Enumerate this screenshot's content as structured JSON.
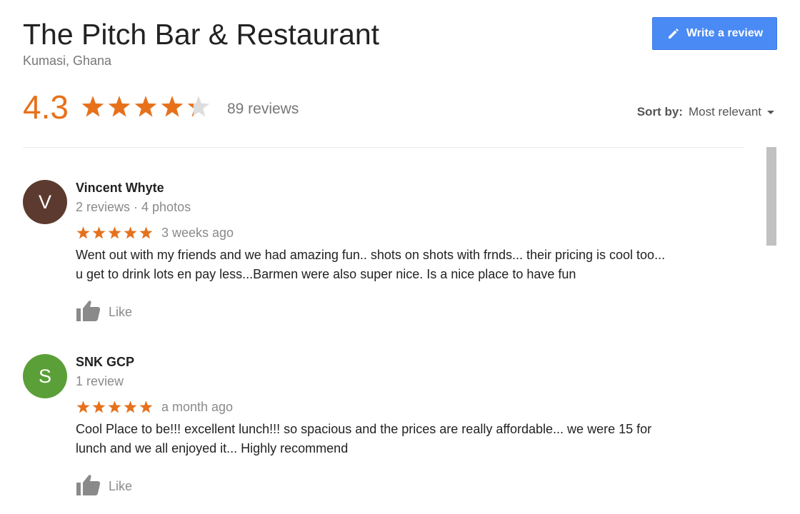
{
  "place": {
    "title": "The Pitch Bar & Restaurant",
    "location": "Kumasi, Ghana"
  },
  "actions": {
    "write_review_label": "Write a review",
    "write_review_icon": "pencil-icon"
  },
  "summary": {
    "rating": "4.3",
    "rating_stars": 4.3,
    "review_count": "89 reviews",
    "star_color": "#e7711b"
  },
  "sort": {
    "label": "Sort by:",
    "value": "Most relevant"
  },
  "reviews": [
    {
      "initial": "V",
      "avatar_color": "#5d3a2f",
      "name": "Vincent Whyte",
      "meta": "2 reviews · 4 photos",
      "stars": 5,
      "date": "3 weeks ago",
      "text_lines": [
        "Went out with my friends and we had amazing fun.. shots on shots with frnds... their pricing is cool too...",
        "u get to drink lots en pay less...Barmen were also super nice. Is a nice place to have fun"
      ],
      "like_label": "Like"
    },
    {
      "initial": "S",
      "avatar_color": "#5b9f38",
      "name": "SNK GCP",
      "meta": "1 review",
      "stars": 5,
      "date": "a month ago",
      "text_lines": [
        "Cool Place to be!!! excellent lunch!!! so spacious and the prices are really affordable... we were 15 for",
        "lunch and we all enjoyed it... Highly recommend"
      ],
      "like_label": "Like"
    }
  ],
  "colors": {
    "accent_blue": "#4a8af4",
    "star_orange": "#e7711b",
    "muted_text": "#8a8a8a"
  }
}
